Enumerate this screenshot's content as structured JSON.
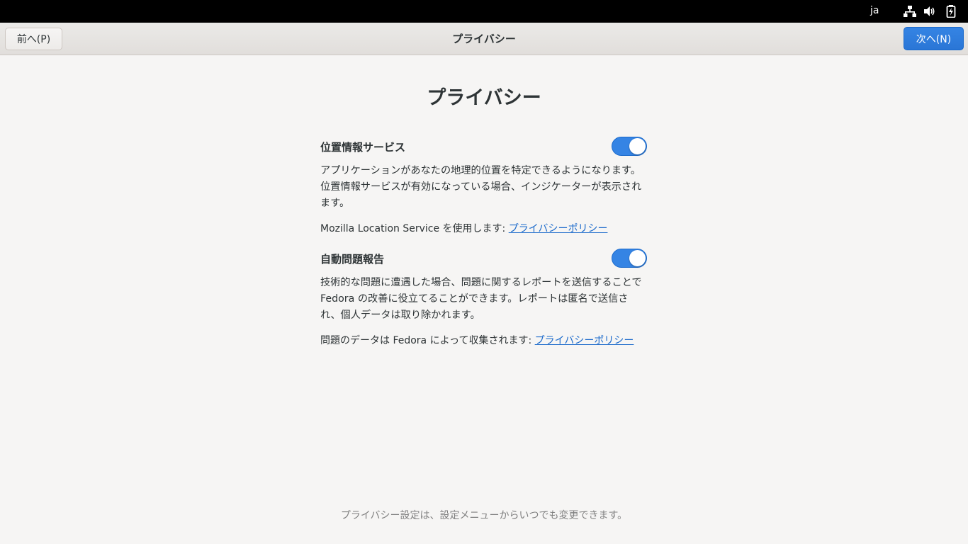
{
  "topbar": {
    "language": "ja",
    "icons": [
      "network-wired-icon",
      "volume-icon",
      "battery-charging-icon"
    ]
  },
  "header": {
    "prev_label": "前へ(P)",
    "title": "プライバシー",
    "next_label": "次へ(N)"
  },
  "page": {
    "title": "プライバシー"
  },
  "location": {
    "title": "位置情報サービス",
    "enabled": true,
    "description": "アプリケーションがあなたの地理的位置を特定できるようになります。位置情報サービスが有効になっている場合、インジケーターが表示されます。",
    "policy_prefix": "Mozilla Location Service を使用します: ",
    "policy_link": "プライバシーポリシー"
  },
  "problem_reporting": {
    "title": "自動問題報告",
    "enabled": true,
    "description": "技術的な問題に遭遇した場合、問題に関するレポートを送信することで Fedora の改善に役立てることができます。レポートは匿名で送信され、個人データは取り除かれます。",
    "policy_prefix": "問題のデータは Fedora によって収集されます: ",
    "policy_link": "プライバシーポリシー"
  },
  "footer": {
    "note": "プライバシー設定は、設定メニューからいつでも変更できます。"
  },
  "colors": {
    "accent": "#3584e4",
    "link": "#1b6acb",
    "background": "#f6f5f4"
  }
}
